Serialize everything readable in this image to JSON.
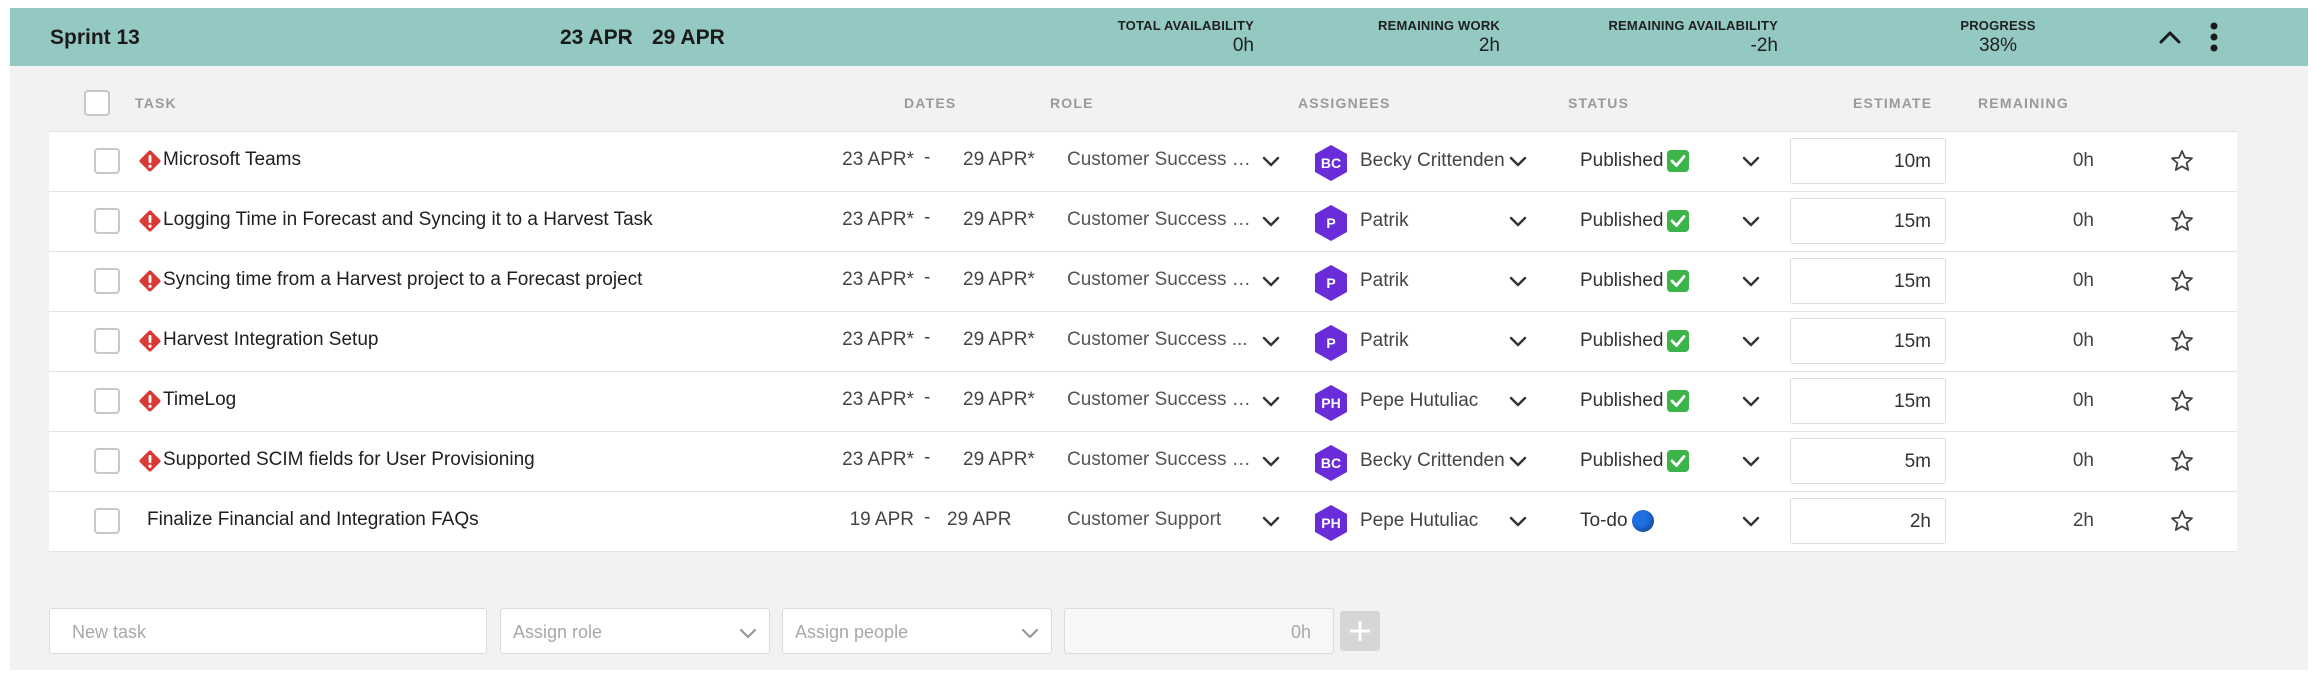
{
  "sprint": {
    "title": "Sprint 13",
    "start": "23 APR",
    "dash": "-",
    "end": "29 APR",
    "total_availability": {
      "label": "TOTAL AVAILABILITY",
      "value": "0h"
    },
    "remaining_work": {
      "label": "REMAINING WORK",
      "value": "2h"
    },
    "remaining_availability": {
      "label": "REMAINING AVAILABILITY",
      "value": "-2h"
    },
    "progress": {
      "label": "PROGRESS",
      "value": "38%"
    }
  },
  "columns": {
    "task": "TASK",
    "dates": "DATES",
    "role": "ROLE",
    "assignees": "ASSIGNEES",
    "status": "STATUS",
    "estimate": "ESTIMATE",
    "remaining": "REMAINING"
  },
  "rows": [
    {
      "name": "Microsoft Teams",
      "warning": true,
      "start": "23 APR*",
      "end": "29 APR*",
      "role": "Customer Success S...",
      "initials": "BC",
      "assignee": "Becky Crittenden",
      "status": "Published",
      "status_icon": "check-icon",
      "estimate": "10m",
      "remaining": "0h"
    },
    {
      "name": "Logging Time in Forecast and Syncing it to a Harvest Task",
      "warning": true,
      "start": "23 APR*",
      "end": "29 APR*",
      "role": "Customer Success S...",
      "initials": "P",
      "assignee": "Patrik",
      "status": "Published",
      "status_icon": "check-icon",
      "estimate": "15m",
      "remaining": "0h"
    },
    {
      "name": "Syncing time from a Harvest project to a Forecast project",
      "warning": true,
      "start": "23 APR*",
      "end": "29 APR*",
      "role": "Customer Success S...",
      "initials": "P",
      "assignee": "Patrik",
      "status": "Published",
      "status_icon": "check-icon",
      "estimate": "15m",
      "remaining": "0h"
    },
    {
      "name": "Harvest Integration Setup",
      "warning": true,
      "start": "23 APR*",
      "end": "29 APR*",
      "role": "Customer Success ...",
      "initials": "P",
      "assignee": "Patrik",
      "status": "Published",
      "status_icon": "check-icon",
      "estimate": "15m",
      "remaining": "0h"
    },
    {
      "name": "TimeLog",
      "warning": true,
      "start": "23 APR*",
      "end": "29 APR*",
      "role": "Customer Success S...",
      "initials": "PH",
      "assignee": "Pepe Hutuliac",
      "status": "Published",
      "status_icon": "check-icon",
      "estimate": "15m",
      "remaining": "0h"
    },
    {
      "name": "Supported SCIM fields for User Provisioning",
      "warning": true,
      "start": "23 APR*",
      "end": "29 APR*",
      "role": "Customer Success S...",
      "initials": "BC",
      "assignee": "Becky Crittenden",
      "status": "Published",
      "status_icon": "check-icon",
      "estimate": "5m",
      "remaining": "0h"
    },
    {
      "name": "Finalize Financial and Integration FAQs",
      "warning": false,
      "start": "19 APR",
      "end": "29 APR",
      "role": "Customer Support",
      "initials": "PH",
      "assignee": "Pepe Hutuliac",
      "status": "To-do",
      "status_icon": "blue-circle-icon",
      "estimate": "2h",
      "remaining": "2h"
    }
  ],
  "new_task": {
    "task_placeholder": "New task",
    "role_placeholder": "Assign role",
    "people_placeholder": "Assign people",
    "hours_placeholder": "0h"
  },
  "colors": {
    "header_bg": "#93c9c2",
    "avatar": "#6a2bd9",
    "warning": "#d93a35",
    "published": "#3cb44a",
    "todo": "#1e6fe0"
  }
}
